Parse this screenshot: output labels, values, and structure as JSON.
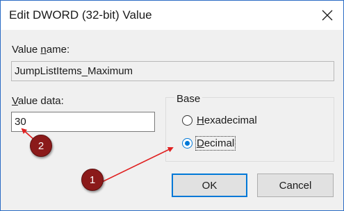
{
  "dialog": {
    "title": "Edit DWORD (32-bit) Value",
    "value_name_label_pre": "Value ",
    "value_name_label_u": "n",
    "value_name_label_post": "ame:",
    "value_name": "JumpListItems_Maximum",
    "value_data_label_u": "V",
    "value_data_label_post": "alue data:",
    "value_data": "30",
    "base_label": "Base",
    "hex_label_u": "H",
    "hex_label_post": "exadecimal",
    "dec_label_u": "D",
    "dec_label_post": "ecimal",
    "selected_base": "Decimal",
    "ok_label": "OK",
    "cancel_label": "Cancel"
  },
  "annotations": {
    "badge_1": "1",
    "badge_2": "2",
    "color": "#e02020"
  },
  "icons": {
    "close": "close-icon"
  }
}
